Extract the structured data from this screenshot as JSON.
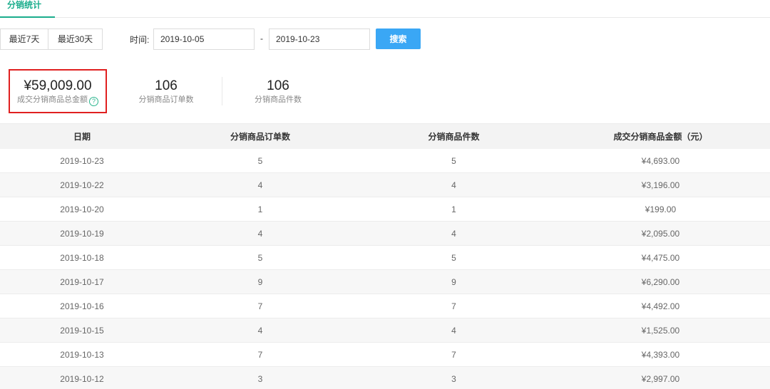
{
  "tabs": [
    {
      "label": "分销统计",
      "active": true
    }
  ],
  "filters": {
    "last7_label": "最近7天",
    "last30_label": "最近30天",
    "time_label": "时间:",
    "start_date": "2019-10-05",
    "separator": "-",
    "end_date": "2019-10-23",
    "search_label": "搜索"
  },
  "stats": [
    {
      "value": "¥59,009.00",
      "label": "成交分销商品总金额",
      "help_icon": "question-circle-icon"
    },
    {
      "value": "106",
      "label": "分销商品订单数"
    },
    {
      "value": "106",
      "label": "分销商品件数"
    }
  ],
  "table": {
    "headers": [
      "日期",
      "分销商品订单数",
      "分销商品件数",
      "成交分销商品金额（元）"
    ],
    "rows": [
      [
        "2019-10-23",
        "5",
        "5",
        "¥4,693.00"
      ],
      [
        "2019-10-22",
        "4",
        "4",
        "¥3,196.00"
      ],
      [
        "2019-10-20",
        "1",
        "1",
        "¥199.00"
      ],
      [
        "2019-10-19",
        "4",
        "4",
        "¥2,095.00"
      ],
      [
        "2019-10-18",
        "5",
        "5",
        "¥4,475.00"
      ],
      [
        "2019-10-17",
        "9",
        "9",
        "¥6,290.00"
      ],
      [
        "2019-10-16",
        "7",
        "7",
        "¥4,492.00"
      ],
      [
        "2019-10-15",
        "4",
        "4",
        "¥1,525.00"
      ],
      [
        "2019-10-13",
        "7",
        "7",
        "¥4,393.00"
      ],
      [
        "2019-10-12",
        "3",
        "3",
        "¥2,997.00"
      ]
    ]
  },
  "colors": {
    "accent": "#1aad8c",
    "search_button": "#3aa7f5",
    "highlight_border": "#e02020"
  }
}
